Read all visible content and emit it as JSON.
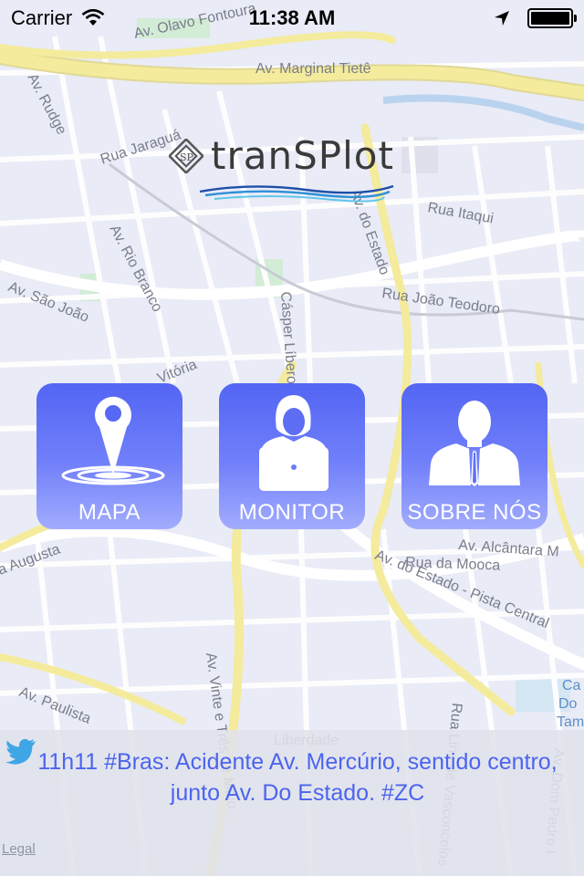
{
  "status_bar": {
    "carrier": "Carrier",
    "time": "11:38 AM",
    "wifi_icon": "wifi-icon",
    "location_icon": "location-arrow-icon",
    "battery_icon": "battery-full-icon"
  },
  "map": {
    "streets": [
      "Av. Olavo Fontoura",
      "Av. Marginal Tietê",
      "Av. Rudge",
      "Rua Jaraguá",
      "Rua Itaqui",
      "Av. do Estado",
      "Av. Rio Branco",
      "Av. São João",
      "Rua João Teodoro",
      "Vitória",
      "Cásper Líbero",
      "Av. Alcântara M",
      "Rua da Mooca",
      "Av. do Estado - Pista Central",
      "a Augusta",
      "Av. Paulista",
      "Av. Vinte e Três de Maio",
      "Liberdade",
      "Rua Lins de Vasconcelos",
      "Av. Dom Pedro I",
      "Ca",
      "Do",
      "Tamar"
    ],
    "legal_label": "Legal"
  },
  "logo": {
    "text": "tranSPlot"
  },
  "tiles": [
    {
      "label": "MAPA",
      "icon": "map-pin-icon"
    },
    {
      "label": "MONITOR",
      "icon": "monitor-operator-icon"
    },
    {
      "label": "SOBRE NÓS",
      "icon": "about-person-icon"
    }
  ],
  "news": {
    "icon": "twitter-bird-icon",
    "text": "11h11 #Bras: Acidente Av. Mercúrio, sentido centro, junto Av. Do Estado. #ZC"
  },
  "colors": {
    "accent": "#4c64ee",
    "tile_top": "#5365f3",
    "tile_bottom": "#a2acfd",
    "highway": "#f4eb9c"
  }
}
